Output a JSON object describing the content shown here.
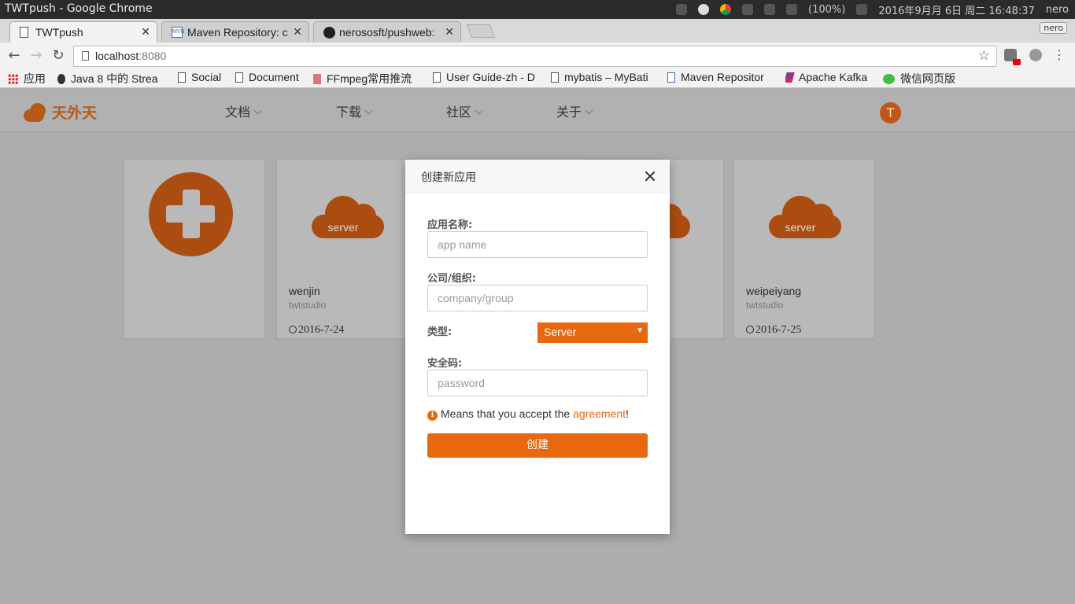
{
  "window": {
    "title": "TWTpush - Google Chrome"
  },
  "tray": {
    "battery": "(100%)",
    "datetime": "2016年9月月 6日 周二 16:48:37",
    "user": "nero"
  },
  "tabs": [
    {
      "title": "TWTpush",
      "active": true
    },
    {
      "title": "Maven Repository: c",
      "active": false
    },
    {
      "title": "nerososft/pushweb: ",
      "active": false
    }
  ],
  "profile_label": "nero",
  "address": {
    "host": "localhost",
    "port": ":8080"
  },
  "bookmarks": [
    {
      "label": "应用",
      "icon": "apps-grid-icon"
    },
    {
      "label": "Java 8 中的 Strea",
      "icon": "github-icon"
    },
    {
      "label": "Social",
      "icon": "page-icon"
    },
    {
      "label": "Document",
      "icon": "page-icon"
    },
    {
      "label": "FFmpeg常用推流",
      "icon": "jianshu-icon"
    },
    {
      "label": "User Guide-zh - D",
      "icon": "page-icon"
    },
    {
      "label": "mybatis – MyBati",
      "icon": "page-icon"
    },
    {
      "label": "Maven Repositor",
      "icon": "maven-icon"
    },
    {
      "label": "Apache Kafka",
      "icon": "kafka-icon"
    },
    {
      "label": "微信网页版",
      "icon": "wechat-icon"
    }
  ],
  "site": {
    "logo_text": "天外天",
    "nav": [
      "文档",
      "下载",
      "社区",
      "关于"
    ],
    "avatar_letter": "T"
  },
  "cards": [
    {
      "name": "wenjin",
      "org": "twtstudio",
      "date": "2016-7-24",
      "icon_label": "server"
    },
    {
      "name": "weipeiyang",
      "org": "twtstudio",
      "date": "2016-7-25",
      "icon_label": "server"
    }
  ],
  "modal": {
    "title": "创建新应用",
    "name_label": "应用名称:",
    "name_placeholder": "app name",
    "company_label": "公司/组织:",
    "company_placeholder": "company/group",
    "type_label": "类型:",
    "type_value": "Server",
    "password_label": "安全码:",
    "password_placeholder": "password",
    "notice_prefix": "Means that you accept the ",
    "notice_link": "agreement",
    "notice_suffix": "!",
    "submit_label": "创建"
  },
  "colors": {
    "accent": "#e8680f",
    "accent_dim": "#ab4c10"
  }
}
